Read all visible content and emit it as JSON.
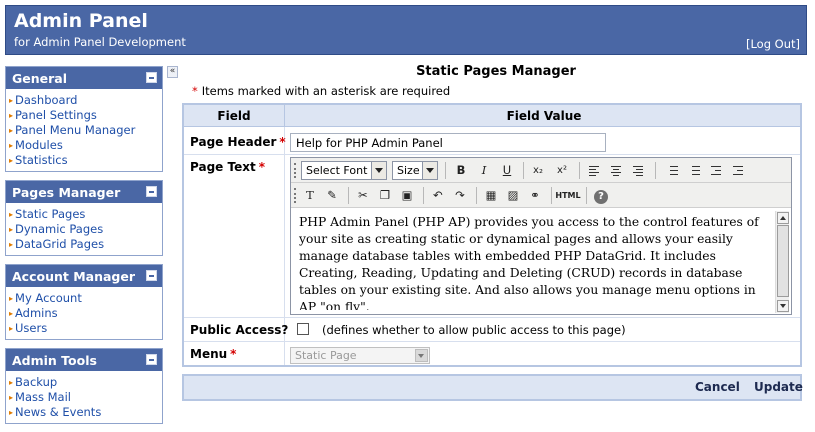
{
  "header": {
    "title": "Admin Panel",
    "subtitle": "for Admin Panel Development",
    "logout": "[Log Out]"
  },
  "sidebar": {
    "collapse_glyph": "«",
    "sections": [
      {
        "title": "General",
        "items": [
          "Dashboard",
          "Panel Settings",
          "Panel Menu Manager",
          "Modules",
          "Statistics"
        ]
      },
      {
        "title": "Pages Manager",
        "items": [
          "Static Pages",
          "Dynamic Pages",
          "DataGrid Pages"
        ]
      },
      {
        "title": "Account Manager",
        "items": [
          "My Account",
          "Admins",
          "Users"
        ]
      },
      {
        "title": "Admin Tools",
        "items": [
          "Backup",
          "Mass Mail",
          "News & Events"
        ]
      }
    ]
  },
  "main": {
    "title": "Static Pages Manager",
    "required_star": "*",
    "required_note": "Items marked with an asterisk are required",
    "table": {
      "col_field": "Field",
      "col_value": "Field Value",
      "page_header_label": "Page Header",
      "page_header_value": "Help for PHP Admin Panel",
      "page_text_label": "Page Text",
      "public_access_label": "Public Access?",
      "public_access_note": "(defines whether to allow public access to this page)",
      "public_access_checked": false,
      "menu_label": "Menu",
      "menu_value": "Static Page"
    },
    "editor": {
      "font_select": "Select Font",
      "size_select": "Size",
      "bold": "B",
      "italic": "I",
      "underline": "U",
      "subscript": "x₂",
      "superscript": "x²",
      "html_button": "HTML",
      "help_button": "?",
      "content": "PHP Admin Panel (PHP AP) provides you access to the control features of your site as creating static or dynamical pages and allows your easily manage database tables with embedded PHP DataGrid. It includes Creating, Reading, Updating and Deleting (CRUD) records in database tables on your existing site. And also allows you manage menu options in AP \"on fly\"."
    },
    "actions": {
      "cancel": "Cancel",
      "update": "Update"
    }
  }
}
